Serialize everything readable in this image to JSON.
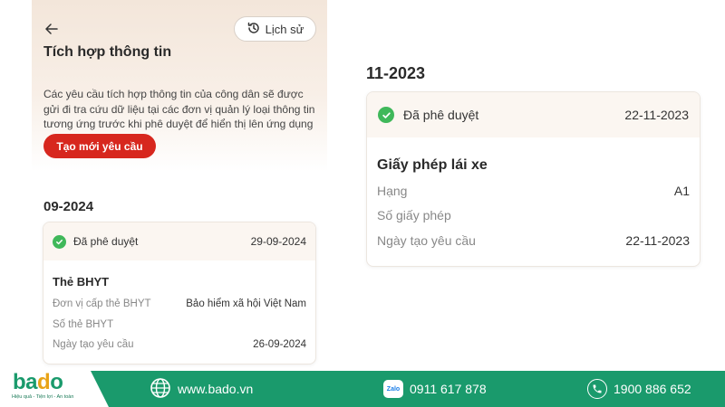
{
  "left": {
    "history_label": "Lịch sử",
    "title": "Tích hợp thông tin",
    "description": "Các yêu cầu tích hợp thông tin của công dân sẽ được gửi đi tra cứu dữ liệu tại các đơn vị quản lý loại thông tin tương ứng trước khi phê duyệt để hiển thị lên ứng dụng",
    "create_button": "Tạo mới yêu cầu",
    "month": "09-2024",
    "card": {
      "status": "Đã phê duyệt",
      "date": "29-09-2024",
      "doc_title": "Thẻ BHYT",
      "rows": [
        {
          "label": "Đơn vị cấp thẻ BHYT",
          "value": "Bảo hiểm xã hội Việt Nam"
        },
        {
          "label": "Số thẻ BHYT",
          "value": ""
        },
        {
          "label": "Ngày tạo yêu cầu",
          "value": "26-09-2024"
        }
      ]
    }
  },
  "right": {
    "month": "11-2023",
    "card": {
      "status": "Đã phê duyệt",
      "date": "22-11-2023",
      "doc_title": "Giấy phép lái xe",
      "rows": [
        {
          "label": "Hạng",
          "value": "A1"
        },
        {
          "label": "Số giấy phép",
          "value": ""
        },
        {
          "label": "Ngày tạo yêu cầu",
          "value": "22-11-2023"
        }
      ]
    }
  },
  "footer": {
    "logo_b": "b",
    "logo_a": "a",
    "logo_d": "d",
    "logo_o": "o",
    "tagline": "Hiệu quả - Tiện lợi - An toàn",
    "website": "www.bado.vn",
    "zalo_label": "Zalo",
    "zalo_phone": "0911 617 878",
    "hotline": "1900 886 652"
  },
  "colors": {
    "accent_red": "#d7271e",
    "approved_green": "#3fb85a",
    "footer_green": "#1a9a6c",
    "logo_orange": "#e8a317"
  },
  "icons": [
    "back-arrow-icon",
    "history-clock-icon",
    "check-circle-icon",
    "globe-icon",
    "zalo-icon",
    "phone-icon"
  ]
}
